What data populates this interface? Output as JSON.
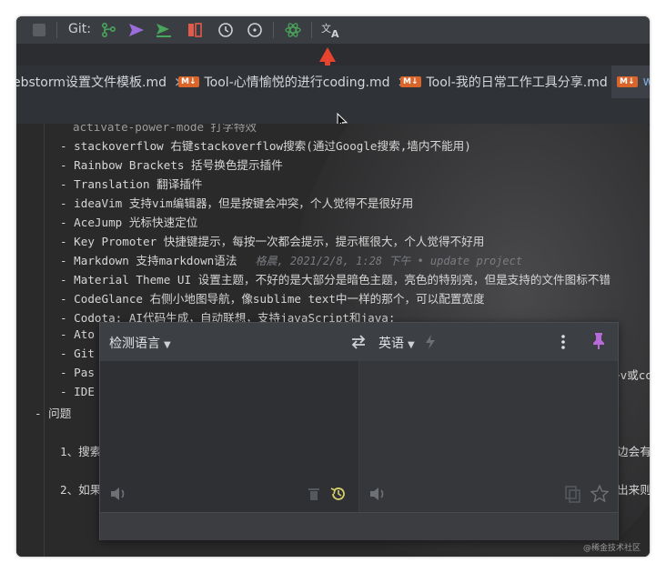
{
  "toolbar": {
    "git_label": "Git:",
    "accent_green": "#49a45c",
    "accent_purple": "#9b6ddb",
    "accent_red": "#e25b4a"
  },
  "tabs": [
    {
      "label": "ebstorm设置文件模板.md",
      "badge": ""
    },
    {
      "label": "Tool-心情愉悦的进行coding.md",
      "badge": "M↓"
    },
    {
      "label": "Tool-我的日常工作工具分享.md",
      "badge": "M↓"
    },
    {
      "label": "wo",
      "badge": "M↓"
    }
  ],
  "editor": {
    "lines": [
      "- stackoverflow 右键stackoverflow搜索(通过Google搜索,墙内不能用)",
      "- Rainbow Brackets 括号换色提示插件",
      "- Translation 翻译插件",
      "- ideaVim 支持vim编辑器，但是按键会冲突，个人觉得不是很好用",
      "- AceJump 光标快速定位",
      "- Key Promoter 快捷键提示，每按一次都会提示，提示框很大，个人觉得不好用",
      "- Markdown 支持markdown语法",
      "- Material Theme UI 设置主题，不好的是大部分是暗色主题，亮色的特别亮，但是支持的文件图标不错",
      "- CodeGlance 右侧小地图导航，像sublime text中一样的那个，可以配置宽度",
      "- Codota: AI代码生成，自动联想，支持javaScript和java;",
      "- Ato",
      "- Git",
      "- Pas",
      "- IDE"
    ],
    "partial_top": "activate-power-mode 打字特效",
    "annotation": "格晨, 2021/2/8, 1:28 下午 • update project",
    "section": "- 问题",
    "q1": "1、搜索",
    "q2": "2、如果",
    "right_frag1": "~v或co",
    "right_frag2": "边会有",
    "right_frag3": "出来则不"
  },
  "translator": {
    "source_lang": "检测语言",
    "target_lang": "英语",
    "pin_color": "#b86ad8"
  },
  "watermark": "@稀金技术社区"
}
